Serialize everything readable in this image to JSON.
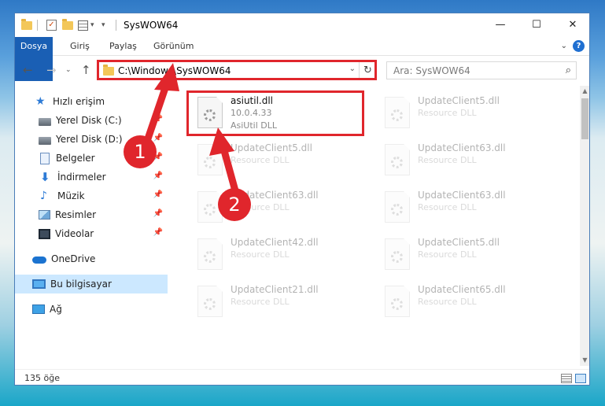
{
  "window": {
    "title": "SysWOW64",
    "minimize": "—",
    "maximize": "☐",
    "close": "✕"
  },
  "ribbon": {
    "tabs": [
      "Dosya",
      "Giriş",
      "Paylaş",
      "Görünüm"
    ],
    "help": "?"
  },
  "address": {
    "path": "C:\\Windows\\SysWOW64",
    "search_placeholder": "Ara: SysWOW64"
  },
  "sidebar": {
    "quick_access": "Hızlı erişim",
    "items": [
      "Yerel Disk (C:)",
      "Yerel Disk (D:)",
      "Belgeler",
      "İndirmeler",
      "Müzik",
      "Resimler",
      "Videolar"
    ],
    "onedrive": "OneDrive",
    "this_pc": "Bu bilgisayar",
    "network": "Ağ"
  },
  "files": {
    "main": {
      "name": "asiutil.dll",
      "version": "10.0.4.33",
      "description": "AsiUtil DLL"
    },
    "ghost_left": [
      {
        "name": "UpdateClient5.dll",
        "description": "Resource DLL"
      },
      {
        "name": "UpdateClient63.dll",
        "description": "Resource DLL"
      },
      {
        "name": "UpdateClient42.dll",
        "description": "Resource DLL"
      },
      {
        "name": "UpdateClient21.dll",
        "description": "Resource DLL"
      }
    ],
    "ghost_right": [
      {
        "name": "UpdateClient5.dll",
        "description": "Resource DLL"
      },
      {
        "name": "UpdateClient63.dll",
        "description": "Resource DLL"
      },
      {
        "name": "UpdateClient63.dll",
        "description": "Resource DLL"
      },
      {
        "name": "UpdateClient5.dll",
        "description": "Resource DLL"
      },
      {
        "name": "UpdateClient65.dll",
        "description": "Resource DLL"
      }
    ]
  },
  "status": {
    "count": "135 öğe"
  },
  "badges": {
    "one": "1",
    "two": "2"
  },
  "annotation_color": "#e0262c"
}
